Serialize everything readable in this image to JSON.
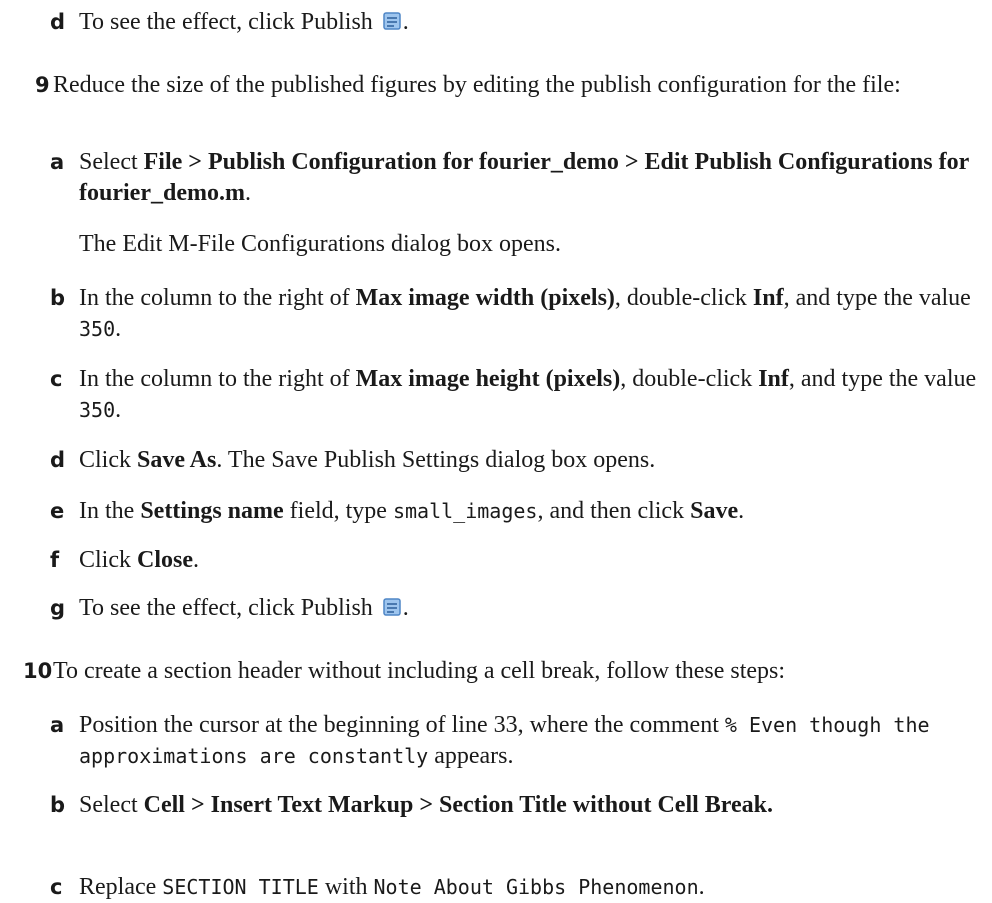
{
  "step8": {
    "d": {
      "label": "d",
      "pre": "To see the effect, click Publish",
      "post": "."
    }
  },
  "step9": {
    "num": "9",
    "text": "Reduce the size of the published figures by editing the publish configuration for the file:",
    "a": {
      "label": "a",
      "pre": "Select ",
      "b1": "File  > Publish Configuration for fourier_demo > Edit Publish Configurations for fourier_demo.m",
      "post": ".",
      "note": "The Edit M-File Configurations dialog box opens."
    },
    "b": {
      "label": "b",
      "pre": "In the column to the right of ",
      "b1": "Max image width (pixels)",
      "mid": ", double-click ",
      "b2": "Inf",
      "mid2": ", and type the value ",
      "code": "350",
      "post": "."
    },
    "c": {
      "label": "c",
      "pre": "In the column to the right of ",
      "b1": "Max image height (pixels)",
      "mid": ", double-click ",
      "b2": "Inf",
      "mid2": ", and type the value ",
      "code": "350",
      "post": "."
    },
    "d": {
      "label": "d",
      "pre": "Click ",
      "b1": "Save As",
      "post": ". The Save Publish Settings dialog box opens."
    },
    "e": {
      "label": "e",
      "pre": "In the ",
      "b1": "Settings name",
      "mid": " field, type ",
      "code": "small_images",
      "mid2": ", and then click ",
      "b2": "Save",
      "post": "."
    },
    "f": {
      "label": "f",
      "pre": "Click ",
      "b1": "Close",
      "post": "."
    },
    "g": {
      "label": "g",
      "pre": "To see the effect, click Publish",
      "post": "."
    }
  },
  "step10": {
    "num": "10",
    "text": "To create a section header without including a cell break, follow these steps:",
    "a": {
      "label": "a",
      "pre": "Position the cursor at the beginning of line 33, where the comment ",
      "code": "% Even though the approximations are constantly",
      "post": " appears."
    },
    "b": {
      "label": "b",
      "pre": "Select ",
      "b1": "Cell > Insert Text Markup > Section Title without Cell Break."
    },
    "c": {
      "label": "c",
      "pre": "Replace ",
      "code1": "SECTION TITLE",
      "mid": " with ",
      "code2": "Note About Gibbs Phenomenon",
      "post": "."
    }
  },
  "icons": {
    "publish": "publish-icon"
  }
}
